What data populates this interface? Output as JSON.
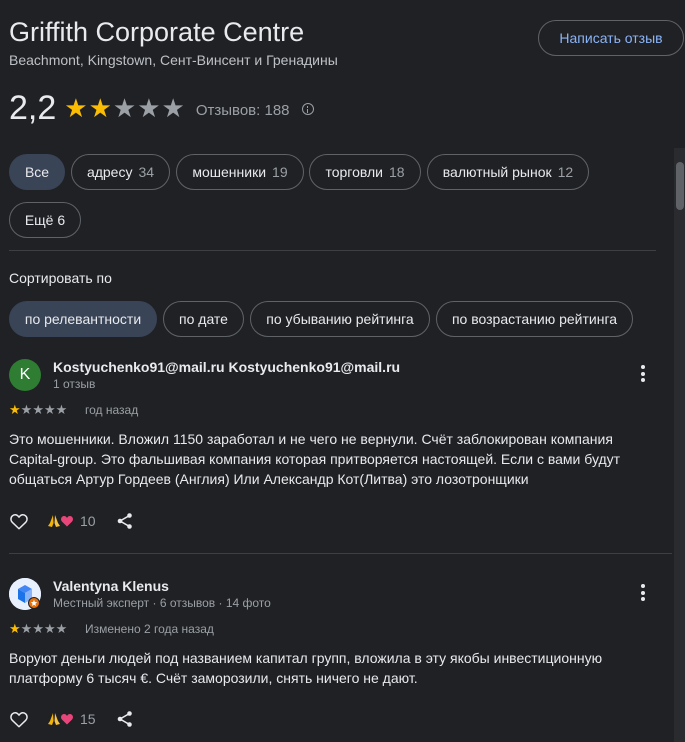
{
  "place": {
    "title": "Griffith Corporate Centre",
    "address": "Beachmont, Kingstown, Сент-Винсент и Гренадины",
    "write_review_label": "Написать отзыв",
    "rating": "2,2",
    "stars_filled": 2,
    "stars_total": 5,
    "reviews_count_label": "Отзывов: 188"
  },
  "filters": [
    {
      "label": "Все",
      "count": ""
    },
    {
      "label": "адресу",
      "count": "34"
    },
    {
      "label": "мошенники",
      "count": "19"
    },
    {
      "label": "торговли",
      "count": "18"
    },
    {
      "label": "валютный рынок",
      "count": "12"
    },
    {
      "label": "Ещё 6",
      "count": ""
    }
  ],
  "sort": {
    "label": "Сортировать по",
    "options": [
      "по релевантности",
      "по дате",
      "по убыванию рейтинга",
      "по возрастанию рейтинга"
    ]
  },
  "reviews": [
    {
      "avatar_letter": "K",
      "author": "Kostyuchenko91@mail.ru Kostyuchenko91@mail.ru",
      "meta": "1 отзыв",
      "rating": 1,
      "when": "год назад",
      "text": "Это мошенники. Вложил 1150 заработал и не чего не вернули. Счёт заблокирован компания Capital-group. Это фальшивая компания которая притворяется настоящей. Если с вами будут общаться Артур Гордеев (Англия) Или Александр Кот(Литва) это лозотронщики",
      "reactions": "10"
    },
    {
      "avatar_letter": "",
      "author": "Valentyna Klenus",
      "meta": "Местный эксперт · 6 отзывов · 14 фото",
      "rating": 1,
      "when": "Изменено 2 года назад",
      "text": "Воруют деньги людей под названием капитал групп, вложила в эту якобы инвестиционную платформу 6 тысяч €. Счёт заморозили, снять ничего не дают.",
      "reactions": "15"
    }
  ],
  "colors": {
    "background": "#202124",
    "star": "#fbbc04",
    "link": "#8ab4f8",
    "active_chip": "#394457"
  }
}
